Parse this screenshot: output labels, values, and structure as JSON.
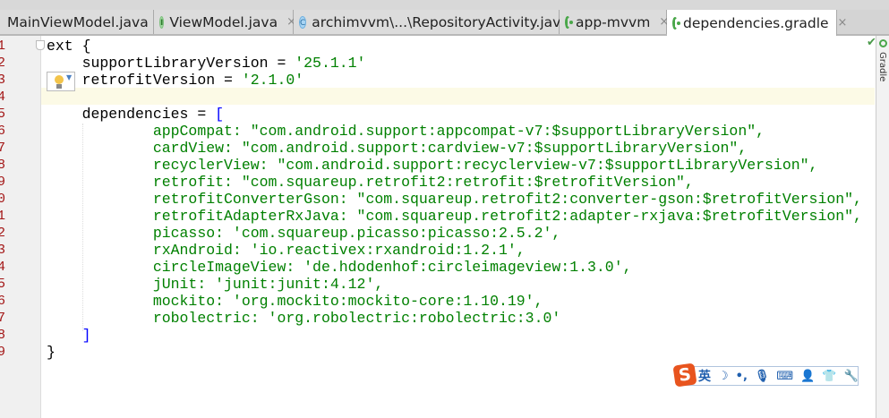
{
  "tabs": [
    {
      "label": "MainViewModel.java",
      "icon": "none"
    },
    {
      "label": "ViewModel.java",
      "icon": "interface-icon"
    },
    {
      "label": "archimvvm\\...\\RepositoryActivity.java",
      "icon": "class-icon"
    },
    {
      "label": "app-mvvm",
      "icon": "gradle-icon"
    },
    {
      "label": "dependencies.gradle",
      "icon": "gradle-icon",
      "active": true
    }
  ],
  "close_glyph": "×",
  "side_panel_label": "Gradle",
  "colors": {
    "string": "#008000",
    "bracket": "#0000ff",
    "text": "#000000",
    "line_number": "#a31515"
  },
  "code_lines": [
    [
      [
        "ext {",
        "t"
      ]
    ],
    [
      [
        "    supportLibraryVersion = ",
        "t"
      ],
      [
        "'25.1.1'",
        "s"
      ]
    ],
    [
      [
        "    retrofitVersion = ",
        "t"
      ],
      [
        "'2.1.0'",
        "s"
      ]
    ],
    [
      [
        "",
        "t"
      ]
    ],
    [
      [
        "    dependencies = ",
        "t"
      ],
      [
        "[",
        "b"
      ]
    ],
    [
      [
        "            appCompat: \"com.android.support:appcompat-v7:$supportLibraryVersion\",",
        "s"
      ]
    ],
    [
      [
        "            cardView: \"com.android.support:cardview-v7:$supportLibraryVersion\",",
        "s"
      ]
    ],
    [
      [
        "            recyclerView: \"com.android.support:recyclerview-v7:$supportLibraryVersion\",",
        "s"
      ]
    ],
    [
      [
        "            retrofit: \"com.squareup.retrofit2:retrofit:$retrofitVersion\",",
        "s"
      ]
    ],
    [
      [
        "            retrofitConverterGson: \"com.squareup.retrofit2:converter-gson:$retrofitVersion\",",
        "s"
      ]
    ],
    [
      [
        "            retrofitAdapterRxJava: \"com.squareup.retrofit2:adapter-rxjava:$retrofitVersion\",",
        "s"
      ]
    ],
    [
      [
        "            picasso: 'com.squareup.picasso:picasso:2.5.2',",
        "s"
      ]
    ],
    [
      [
        "            rxAndroid: 'io.reactivex:rxandroid:1.2.1',",
        "s"
      ]
    ],
    [
      [
        "            circleImageView: 'de.hdodenhof:circleimageview:1.3.0',",
        "s"
      ]
    ],
    [
      [
        "            jUnit: 'junit:junit:4.12',",
        "s"
      ]
    ],
    [
      [
        "            mockito: 'org.mockito:mockito-core:1.10.19',",
        "s"
      ]
    ],
    [
      [
        "            robolectric: 'org.robolectric:robolectric:3.0'",
        "s"
      ]
    ],
    [
      [
        "    ",
        "t"
      ],
      [
        "]",
        "b"
      ]
    ],
    [
      [
        "}",
        "t"
      ]
    ]
  ],
  "line_numbers": [
    "1",
    "2",
    "3",
    "4",
    "5",
    "6",
    "7",
    "8",
    "9",
    "0",
    "1",
    "2",
    "3",
    "4",
    "5",
    "6",
    "7",
    "8",
    "9"
  ],
  "ime": {
    "logo": "S",
    "lang": "英",
    "items": [
      "☽",
      "•,",
      "🎙",
      "⌨",
      "👤",
      "👕",
      "🔧"
    ]
  }
}
